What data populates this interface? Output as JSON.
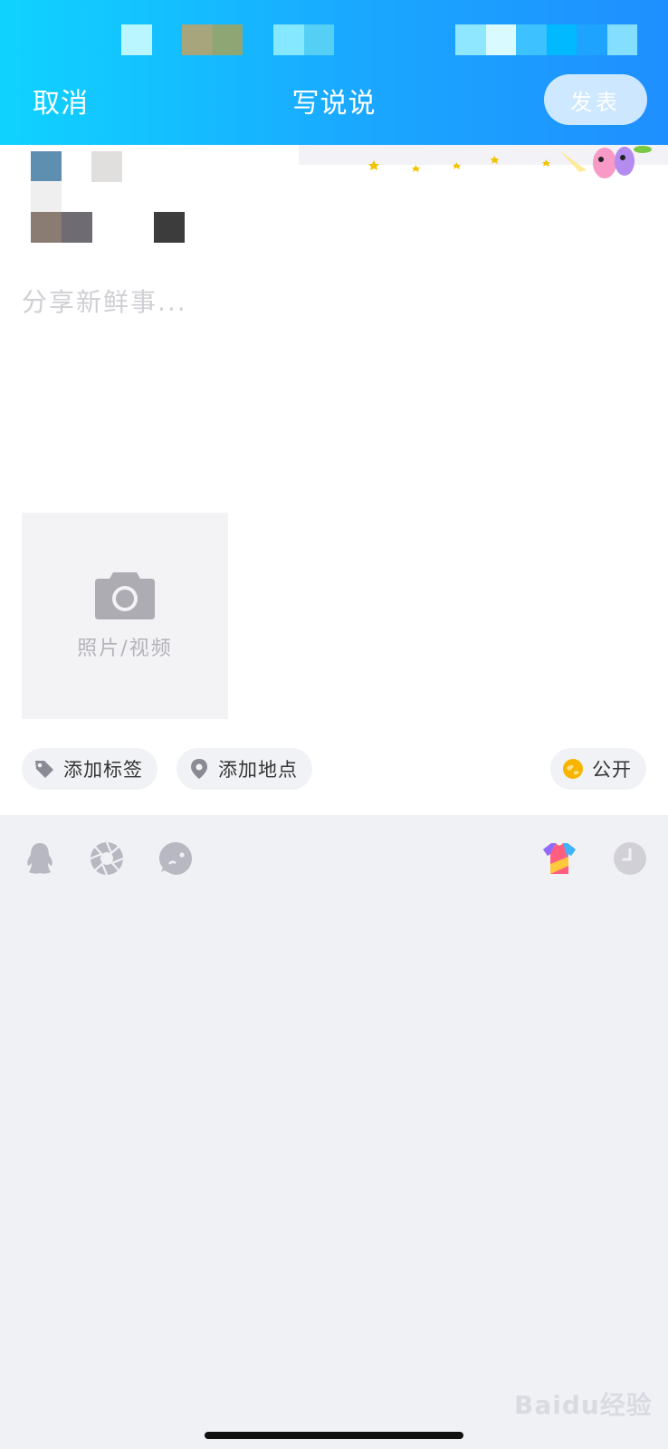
{
  "header": {
    "cancel_label": "取消",
    "title": "写说说",
    "publish_label": "发表"
  },
  "composer": {
    "placeholder": "分享新鲜事..."
  },
  "media": {
    "add_label": "照片/视频"
  },
  "chips": {
    "add_tag": "添加标签",
    "add_location": "添加地点",
    "visibility": "公开"
  },
  "toolbar": {
    "icons": [
      "qq-icon",
      "shutter-icon",
      "emoji-icon",
      "theme-shirt-icon",
      "clock-icon"
    ]
  },
  "watermark": {
    "text": "Baidu经验"
  },
  "colors": {
    "header_start": "#0fd3ff",
    "header_end": "#1f8fff",
    "panel_bg": "#f0f1f5",
    "chip_bg": "#f1f2f5",
    "muted_icon": "#b8b8c2",
    "visibility_icon": "#f7b500"
  }
}
